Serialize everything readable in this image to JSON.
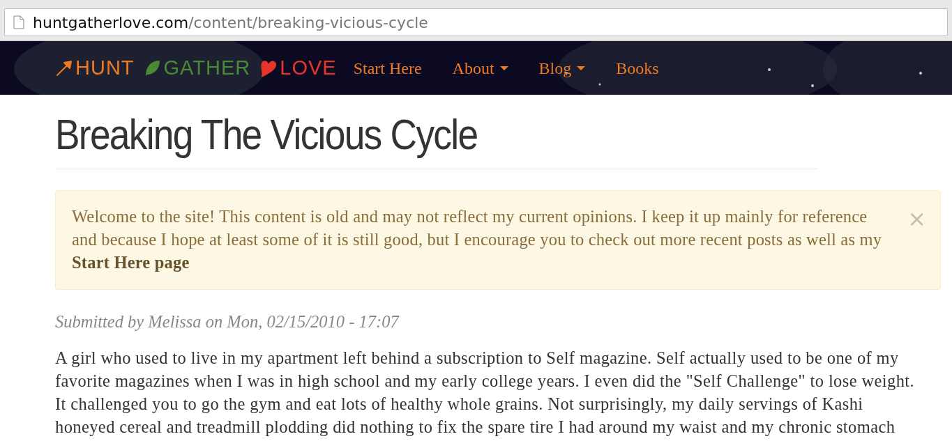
{
  "address_bar": {
    "domain": "huntgatherlove.com",
    "path": "/content/breaking-vicious-cycle"
  },
  "logo": [
    {
      "kind": "arrow",
      "word": "HUNT",
      "color": "#f07a22"
    },
    {
      "kind": "leaf",
      "word": "GATHER",
      "color": "#4a8a34"
    },
    {
      "kind": "heart",
      "word": "LOVE",
      "color": "#e8352a"
    }
  ],
  "nav": [
    {
      "label": "Start Here",
      "dropdown": false
    },
    {
      "label": "About",
      "dropdown": true
    },
    {
      "label": "Blog",
      "dropdown": true
    },
    {
      "label": "Books",
      "dropdown": false
    }
  ],
  "title": "Breaking The Vicious Cycle",
  "alert": {
    "text": "Welcome to the site! This content is old and may not reflect my current opinions. I keep it up mainly for reference and because I hope at least some of it is still good, but I encourage you to check out more recent posts as well as my **Start Here page**",
    "close": "×"
  },
  "submitted": "Submitted by Melissa on Mon, 02/15/2010 - 17:07",
  "body_lines": [
    "A girl who used to live in my apartment left behind a subscription to Self magazine. Self actually used to be one of my",
    "favorite magazines when I was in high school and my early college years. I even did the \"Self Challenge\" to lose weight.",
    "It challenged you to go the gym and eat lots of healthy whole grains. Not surprisingly, my daily servings of Kashi",
    "honeyed cereal and treadmill plodding did nothing to fix the spare tire I had around my waist and my chronic stomach"
  ]
}
